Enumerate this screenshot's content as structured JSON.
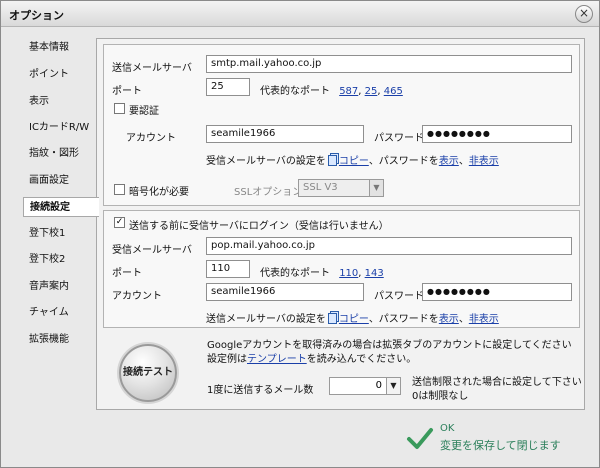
{
  "window": {
    "title": "オプション",
    "close_glyph": "×"
  },
  "sidebar": {
    "items": [
      {
        "label": "基本情報"
      },
      {
        "label": "ポイント"
      },
      {
        "label": "表示"
      },
      {
        "label": "ICカードR/W"
      },
      {
        "label": "指紋・図形"
      },
      {
        "label": "画面設定"
      },
      {
        "label": "接続設定"
      },
      {
        "label": "登下校1"
      },
      {
        "label": "登下校2"
      },
      {
        "label": "音声案内"
      },
      {
        "label": "チャイム"
      },
      {
        "label": "拡張機能"
      }
    ],
    "active_index": 6
  },
  "smtp": {
    "server_label": "送信メールサーバ",
    "server_value": "smtp.mail.yahoo.co.jp",
    "port_label": "ポート",
    "port_value": "25",
    "typical_label": "代表的なポート",
    "typical_ports": [
      "587",
      "25",
      "465"
    ],
    "auth_label": "要認証",
    "auth_checked": false,
    "account_label": "アカウント",
    "account_value": "seamile1966",
    "password_label": "パスワード",
    "password_value": "●●●●●●●●",
    "copy_prefix": "受信メールサーバの設定を",
    "copy_link": "コピー",
    "copy_mid": "、パスワードを",
    "show_link": "表示",
    "hide_link": "非表示",
    "ssl_label": "暗号化が必要",
    "ssl_checked": false,
    "ssl_option_label": "SSLオプション",
    "ssl_option_value": "SSL V3"
  },
  "pop": {
    "login_label": "送信する前に受信サーバにログイン（受信は行いません）",
    "login_checked": true,
    "server_label": "受信メールサーバ",
    "server_value": "pop.mail.yahoo.co.jp",
    "port_label": "ポート",
    "port_value": "110",
    "typical_label": "代表的なポート",
    "typical_ports": [
      "110",
      "143"
    ],
    "account_label": "アカウント",
    "account_value": "seamile1966",
    "password_label": "パスワード",
    "password_value": "●●●●●●●●",
    "copy_prefix": "送信メールサーバの設定を",
    "copy_link": "コピー",
    "copy_mid": "、パスワードを",
    "show_link": "表示",
    "hide_link": "非表示"
  },
  "bottom": {
    "test_button": "接続テスト",
    "google_note_1": "Googleアカウントを取得済みの場合は拡張タブのアカウントに設定してください",
    "google_note_2_prefix": "設定例は",
    "google_note_2_link": "テンプレート",
    "google_note_2_suffix": "を読み込んでください。",
    "batch_label": "1度に送信するメール数",
    "batch_value": "0",
    "limit_note_1": "送信制限された場合に設定して下さい",
    "limit_note_2": "0は制限なし"
  },
  "footer": {
    "ok_label": "OK",
    "ok_sub": "変更を保存して閉じます",
    "accent": "#2a7f5a"
  }
}
